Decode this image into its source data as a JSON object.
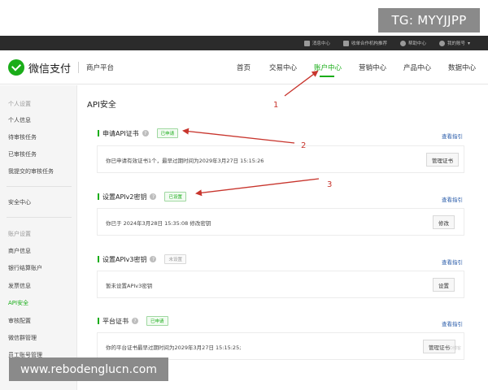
{
  "watermarks": {
    "top": "TG: MYYJJPP",
    "bottom": "www.rebodenglucn.com",
    "faint": "@51CTO博客"
  },
  "topbar": {
    "items": [
      {
        "label": "消息中心"
      },
      {
        "label": "收单合作机构推荐"
      },
      {
        "label": "帮助中心"
      },
      {
        "label": "我的账号"
      }
    ]
  },
  "header": {
    "logo_text": "微信支付",
    "merchant_label": "商户平台",
    "nav": [
      {
        "label": "首页"
      },
      {
        "label": "交易中心"
      },
      {
        "label": "账户中心"
      },
      {
        "label": "营销中心"
      },
      {
        "label": "产品中心"
      },
      {
        "label": "数据中心"
      }
    ],
    "accent_color": "#1aad19"
  },
  "sidebar": {
    "groups": [
      {
        "label": "个人设置"
      },
      {
        "label": "账户设置"
      }
    ],
    "items": [
      {
        "label": "个人信息"
      },
      {
        "label": "待审核任务"
      },
      {
        "label": "已审核任务"
      },
      {
        "label": "我提交的审核任务"
      },
      {
        "label": "安全中心"
      },
      {
        "label": "商户信息"
      },
      {
        "label": "银行结算账户"
      },
      {
        "label": "发票信息"
      },
      {
        "label": "API安全"
      },
      {
        "label": "审核配置"
      },
      {
        "label": "微信群管理"
      },
      {
        "label": "员工账号管理"
      }
    ]
  },
  "main": {
    "page_title": "API安全",
    "sections": [
      {
        "title": "申请API证书",
        "badge": "已申请",
        "guide": "查看指引",
        "text": "你已申请有效证书1个，最早过期时间为2029年3月27日 15:15:26",
        "button": "管理证书"
      },
      {
        "title": "设置APIv2密钥",
        "badge": "已设置",
        "guide": "查看指引",
        "text": "你已于 2024年3月28日 15:35:08 修改密钥",
        "button": "修改"
      },
      {
        "title": "设置APIv3密钥",
        "badge": "未设置",
        "guide": "查看指引",
        "text": "暂未设置APIv3密钥",
        "button": "设置"
      },
      {
        "title": "平台证书",
        "badge": "已申请",
        "guide": "查看指引",
        "text": "你的平台证书最早过期时间为2029年3月27日 15:15:25;",
        "button": "管理证书"
      }
    ]
  },
  "annotations": {
    "labels": [
      "1",
      "2",
      "3"
    ],
    "color": "#c8352d"
  }
}
